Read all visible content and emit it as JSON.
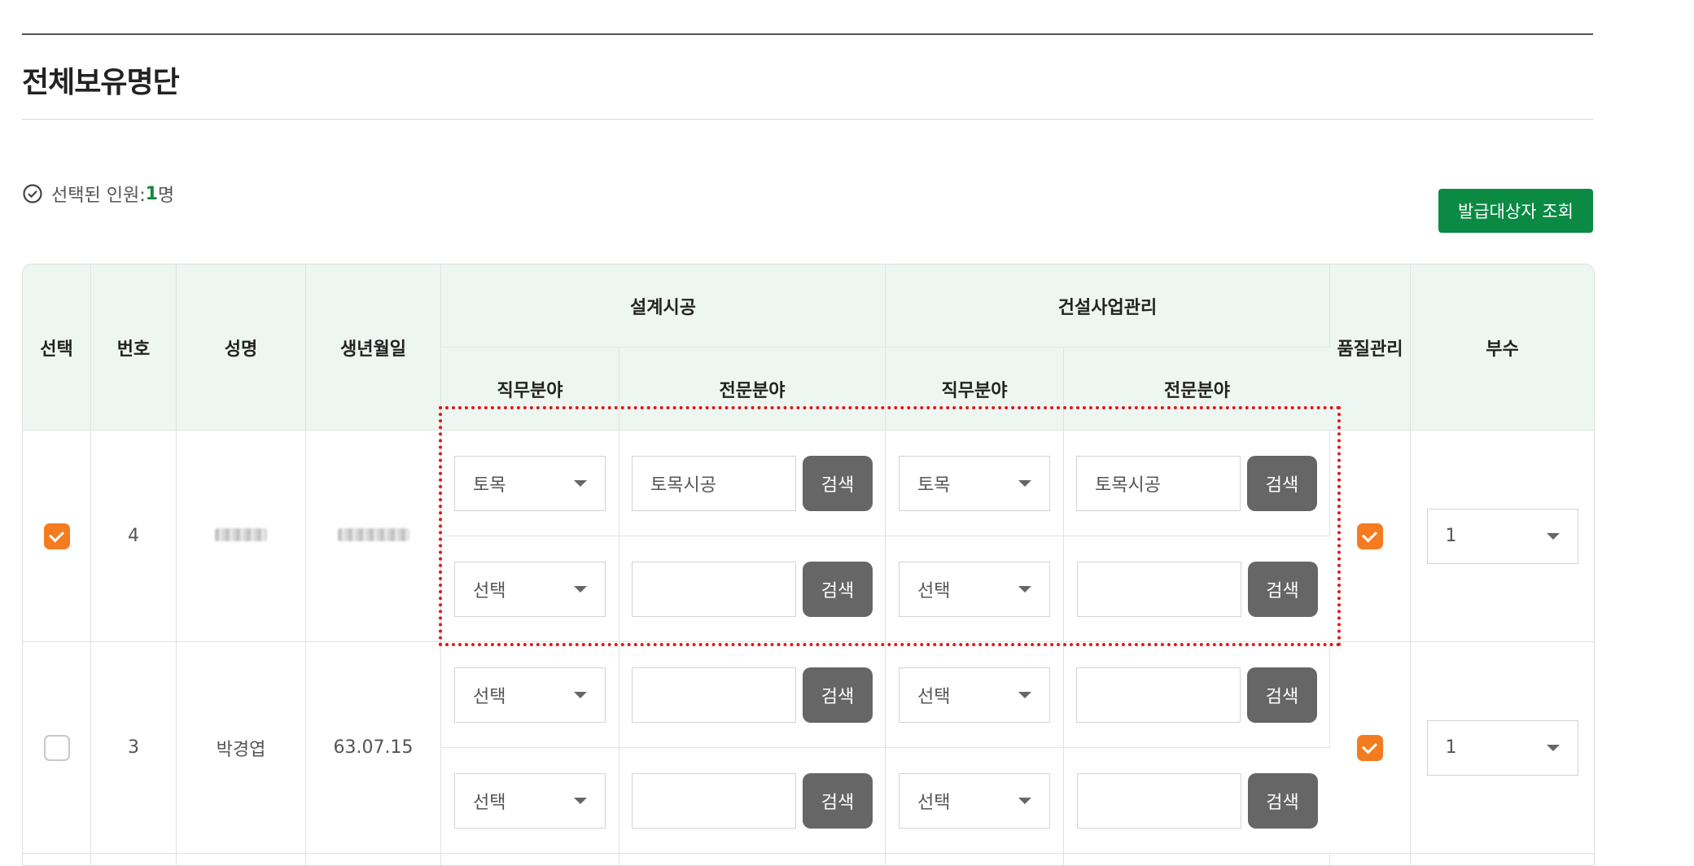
{
  "page": {
    "title": "전체보유명단"
  },
  "selection": {
    "label": "선택된 인원: ",
    "count": "1",
    "unit": "명"
  },
  "issue_button": "발급대상자 조회",
  "table": {
    "headers": {
      "select": "선택",
      "number": "번호",
      "name": "성명",
      "birth": "생년월일",
      "design_group": "설계시공",
      "mgmt_group": "건설사업관리",
      "job_field": "직무분야",
      "specialty": "전문분야",
      "quality": "품질관리",
      "copies": "부수"
    },
    "search_label": "검색",
    "rows": [
      {
        "checked": true,
        "number": "4",
        "name": "",
        "birth": "",
        "quality_checked": true,
        "copies": "1",
        "lines": [
          {
            "design_job": "토목",
            "design_spec": "토목시공",
            "mgmt_job": "토목",
            "mgmt_spec": "토목시공"
          },
          {
            "design_job": "선택",
            "design_spec": "",
            "mgmt_job": "선택",
            "mgmt_spec": ""
          }
        ]
      },
      {
        "checked": false,
        "number": "3",
        "name": "박경엽",
        "birth": "63.07.15",
        "quality_checked": true,
        "copies": "1",
        "lines": [
          {
            "design_job": "선택",
            "design_spec": "",
            "mgmt_job": "선택",
            "mgmt_spec": ""
          },
          {
            "design_job": "선택",
            "design_spec": "",
            "mgmt_job": "선택",
            "mgmt_spec": ""
          }
        ]
      }
    ]
  },
  "colors": {
    "accent_green": "#0a8a43",
    "check_orange": "#f47b20",
    "highlight_red": "#e01818"
  }
}
